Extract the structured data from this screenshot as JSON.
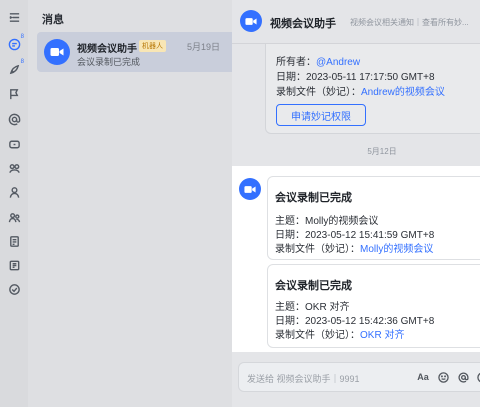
{
  "sidebar": {
    "icons": [
      "collapse-icon",
      "messages-icon",
      "rocket-icon",
      "flag-icon",
      "mention-icon",
      "tag-icon",
      "bot-icon",
      "contacts-icon",
      "groups-icon",
      "doc-icon",
      "export-icon",
      "todo-icon"
    ],
    "badge": "8"
  },
  "list": {
    "title": "消息",
    "chat": {
      "name": "视频会议助手",
      "badge": "机器人",
      "date": "5月19日",
      "preview": "会议录制已完成"
    }
  },
  "header": {
    "title": "视频会议助手",
    "subtitle": "视频会议相关通知｜查看所有妙..."
  },
  "previous_card": {
    "owner_label": "所有者：",
    "owner_value": "@Andrew",
    "date_label": "日期：",
    "date_value": "2023-05-11 17:17:50 GMT+8",
    "file_label": "录制文件（妙记）：",
    "file_value": "Andrew的视频会议",
    "button": "申请妙记权限"
  },
  "date_separator": "5月12日",
  "cards": [
    {
      "title": "会议录制已完成",
      "topic_label": "主题：",
      "topic_value": "Molly的视频会议",
      "date_label": "日期：",
      "date_value": "2023-05-12 15:41:59 GMT+8",
      "file_label": "录制文件（妙记）：",
      "file_value": "Molly的视频会议"
    },
    {
      "title": "会议录制已完成",
      "topic_label": "主题：",
      "topic_value": "OKR 对齐",
      "date_label": "日期：",
      "date_value": "2023-05-12 15:42:36 GMT+8",
      "file_label": "录制文件（妙记）：",
      "file_value": "OKR 对齐"
    }
  ],
  "composer": {
    "placeholder": "发送给 视频会议助手｜9991",
    "format_label": "Aa"
  },
  "colors": {
    "accent": "#3370ff",
    "badge_bg": "#f8e6b5"
  }
}
